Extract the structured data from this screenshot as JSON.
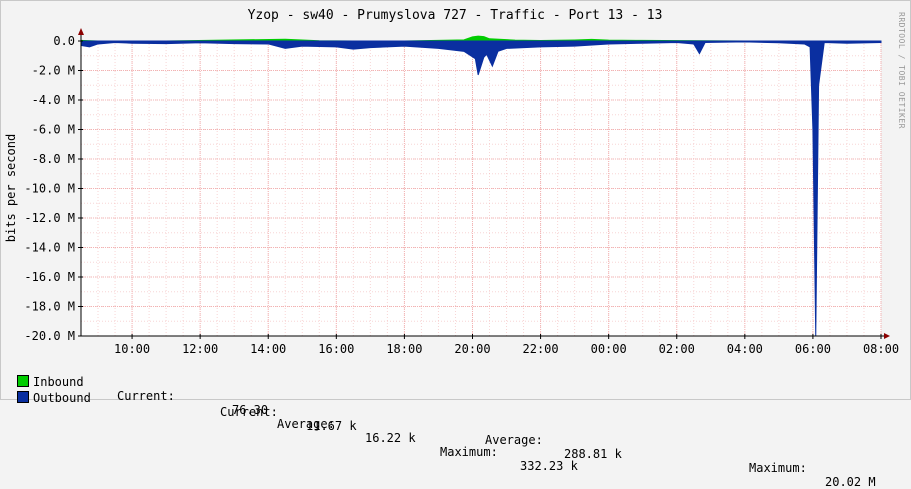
{
  "colors": {
    "inbound": "#00cc00",
    "outbound": "#0a2fa0",
    "background": "#f3f3f3",
    "plot_bg": "#ffffff",
    "grid": "#f2b3b3",
    "axis": "#000000",
    "arrow": "#8b0000"
  },
  "chart_data": {
    "type": "area",
    "title": "Yzop - sw40 - Prumyslova 727 - Traffic - Port 13 - 13",
    "ylabel": "bits per second",
    "vertical_text": "RRDTOOL / TOBI OETIKER",
    "ylim": [
      -20000000,
      0
    ],
    "xlim": [
      "08:30",
      "08:00"
    ],
    "y_ticks": [
      {
        "value": 0,
        "label": "0.0"
      },
      {
        "value": -2000000,
        "label": "-2.0 M"
      },
      {
        "value": -4000000,
        "label": "-4.0 M"
      },
      {
        "value": -6000000,
        "label": "-6.0 M"
      },
      {
        "value": -8000000,
        "label": "-8.0 M"
      },
      {
        "value": -10000000,
        "label": "-10.0 M"
      },
      {
        "value": -12000000,
        "label": "-12.0 M"
      },
      {
        "value": -14000000,
        "label": "-14.0 M"
      },
      {
        "value": -16000000,
        "label": "-16.0 M"
      },
      {
        "value": -18000000,
        "label": "-18.0 M"
      },
      {
        "value": -20000000,
        "label": "-20.0 M"
      }
    ],
    "x_ticks": [
      "10:00",
      "12:00",
      "14:00",
      "16:00",
      "18:00",
      "20:00",
      "22:00",
      "00:00",
      "02:00",
      "04:00",
      "06:00",
      "08:00"
    ],
    "grid": true,
    "series": [
      {
        "name": "Inbound",
        "color": "#00cc00",
        "x": [
          "08:30",
          "09:00",
          "11:00",
          "14:30",
          "15:30",
          "16:30",
          "18:00",
          "19:45",
          "20:00",
          "20:10",
          "20:20",
          "20:30",
          "21:00",
          "21:15",
          "22:00",
          "23:00",
          "23:30",
          "00:00",
          "01:00",
          "04:00",
          "06:00",
          "07:00",
          "08:00"
        ],
        "values": [
          40000,
          0,
          0,
          120000,
          20000,
          0,
          0,
          80000,
          280000,
          332230,
          300000,
          150000,
          90000,
          60000,
          30000,
          70000,
          110000,
          60000,
          40000,
          0,
          0,
          0,
          0
        ]
      },
      {
        "name": "Outbound",
        "color": "#0a2fa0",
        "x": [
          "08:30",
          "08:45",
          "09:00",
          "09:30",
          "10:00",
          "11:00",
          "12:00",
          "13:00",
          "14:00",
          "14:30",
          "15:00",
          "16:00",
          "16:30",
          "17:00",
          "18:00",
          "19:00",
          "19:45",
          "20:05",
          "20:10",
          "20:20",
          "20:25",
          "20:35",
          "20:45",
          "21:00",
          "22:00",
          "23:00",
          "00:00",
          "01:00",
          "02:00",
          "02:30",
          "02:40",
          "02:50",
          "03:30",
          "04:00",
          "05:00",
          "05:45",
          "05:55",
          "06:00",
          "06:05",
          "06:10",
          "06:20",
          "07:00",
          "08:00"
        ],
        "values": [
          -300000,
          -400000,
          -200000,
          -100000,
          -150000,
          -180000,
          -120000,
          -180000,
          -200000,
          -500000,
          -350000,
          -400000,
          -550000,
          -450000,
          -350000,
          -500000,
          -700000,
          -1200000,
          -2300000,
          -1100000,
          -900000,
          -1700000,
          -700000,
          -500000,
          -400000,
          -350000,
          -200000,
          -150000,
          -100000,
          -200000,
          -850000,
          -100000,
          -80000,
          -60000,
          -120000,
          -200000,
          -400000,
          -6000000,
          -20020000,
          -3000000,
          -100000,
          -150000,
          -100000
        ]
      }
    ]
  },
  "legend": {
    "inbound": {
      "name": "Inbound",
      "current_label": "Current:",
      "current": "76.30",
      "average_label": "Average:",
      "average": "16.22 k",
      "maximum_label": "Maximum:",
      "maximum": "332.23 k"
    },
    "outbound": {
      "name": "Outbound",
      "current_label": "Current:",
      "current": "11.67 k",
      "average_label": "Average:",
      "average": "288.81 k",
      "maximum_label": "Maximum:",
      "maximum": "20.02 M"
    }
  }
}
